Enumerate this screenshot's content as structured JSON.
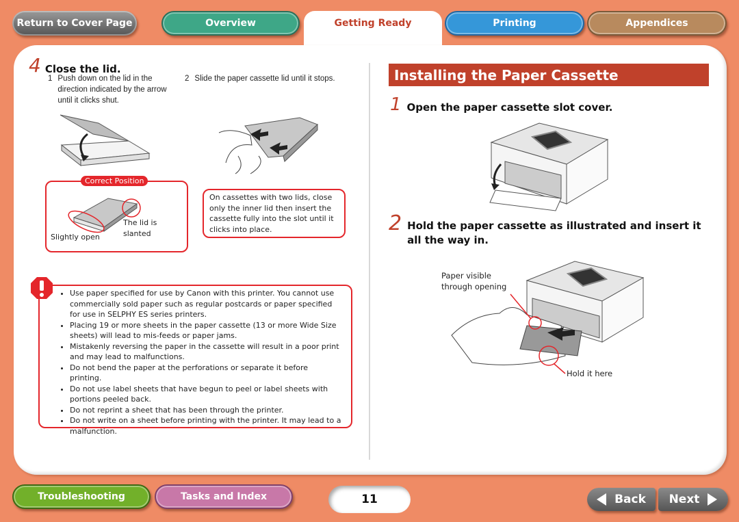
{
  "nav": {
    "cover": "Return to Cover Page",
    "tabs": [
      {
        "label": "Overview",
        "active": false
      },
      {
        "label": "Getting Ready",
        "active": true
      },
      {
        "label": "Printing",
        "active": false
      },
      {
        "label": "Appendices",
        "active": false
      }
    ]
  },
  "left": {
    "step4": {
      "number": "4",
      "title": "Close the lid.",
      "sub": [
        {
          "n": "1",
          "text": "Push down on the lid in the direction indicated by the arrow until it clicks shut."
        },
        {
          "n": "2",
          "text": "Slide the paper cassette lid until it stops."
        }
      ]
    },
    "correct_position": {
      "badge": "Correct Position",
      "label_lid": "The lid is slanted",
      "label_open": "Slightly open"
    },
    "tip": "On cassettes with two lids, close only the inner lid then insert the cassette fully into the slot until it clicks into place.",
    "warnings": [
      "Use paper specified for use by Canon with this printer. You cannot use commercially sold paper such as regular postcards or paper specified for use in SELPHY ES series printers.",
      "Placing 19 or more sheets in the paper cassette (13 or more Wide Size sheets) will lead to mis-feeds or paper jams.",
      "Mistakenly reversing the paper in the cassette will result in a poor print and may lead to malfunctions.",
      "Do not bend the paper at the perforations or separate it before printing.",
      "Do not use label sheets that have begun to peel or label sheets with portions peeled back.",
      "Do not reprint a sheet that has been through the printer.",
      "Do not write on a sheet before printing with the printer. It may lead to a malfunction."
    ]
  },
  "right": {
    "section_title": "Installing the Paper Cassette",
    "step1": {
      "number": "1",
      "title": "Open the paper cassette slot cover."
    },
    "step2": {
      "number": "2",
      "title": "Hold the paper cassette as illustrated and insert it all the way in."
    },
    "callout_paper": "Paper visible through opening",
    "callout_hold": "Hold it here"
  },
  "footer": {
    "troubleshooting": "Troubleshooting",
    "tasks": "Tasks and Index",
    "page": "11",
    "back": "Back",
    "next": "Next"
  }
}
